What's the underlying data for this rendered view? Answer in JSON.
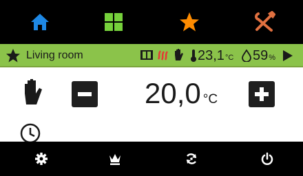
{
  "room": {
    "name": "Living room"
  },
  "status": {
    "current_temp": "23,1",
    "temp_unit": "°C",
    "humidity": "59",
    "humidity_unit": "%"
  },
  "control": {
    "setpoint": "20,0",
    "setpoint_unit": "°C",
    "mode": "manual"
  },
  "icons": {
    "top_tabs": [
      "home-icon",
      "grid-icon",
      "star-icon",
      "tools-icon"
    ],
    "status": [
      "window-icon",
      "heat-icon",
      "hand-icon",
      "thermometer-icon",
      "drop-icon"
    ],
    "bottom": [
      "gear-icon",
      "crown-icon",
      "sync-icon",
      "power-icon"
    ]
  },
  "colors": {
    "home": "#1e88e5",
    "grid": "#76d13b",
    "star": "#ff8c00",
    "tools": "#e07040",
    "roombar": "#8bc34a",
    "heat": "#e53935"
  }
}
